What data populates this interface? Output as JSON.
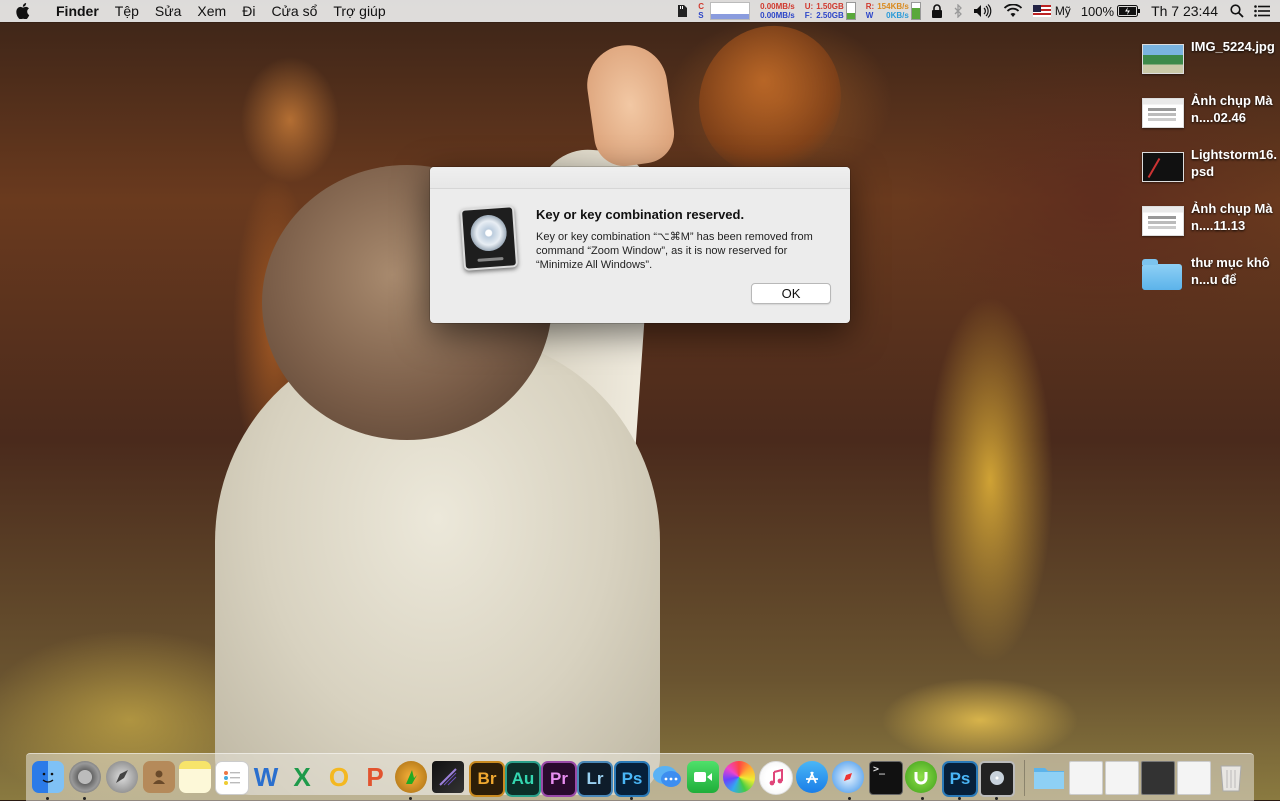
{
  "menubar": {
    "app_name": "Finder",
    "menus": [
      "Tệp",
      "Sửa",
      "Xem",
      "Đi",
      "Cửa sổ",
      "Trợ giúp"
    ],
    "status": {
      "net_up": "0.00MB/s",
      "net_down": "0.00MB/s",
      "mem_u_label": "U:",
      "mem_u": "1.50GB",
      "mem_f_label": "F:",
      "mem_f": "2.50GB",
      "disk_r_label": "R:",
      "disk_w_label": "W",
      "disk_r": "154KB/s",
      "disk_w": "0KB/s",
      "input_source": "Mỹ",
      "battery": "100%",
      "clock": "Th 7 23:44"
    }
  },
  "dialog": {
    "title": "Key or key combination reserved.",
    "message": "Key or key combination “⌥⌘M” has been removed from command “Zoom Window”, as it is now reserved for “Minimize All Windows”.",
    "ok_label": "OK"
  },
  "desktop": {
    "items": [
      {
        "label": "IMG_5224.jpg",
        "kind": "photo"
      },
      {
        "label": "Ảnh chụp Màn....02.46",
        "kind": "screenshot"
      },
      {
        "label": "Lightstorm16.psd",
        "kind": "psd"
      },
      {
        "label": "Ảnh chụp Màn....11.13",
        "kind": "screenshot"
      },
      {
        "label": "thư mục khôn...u để",
        "kind": "folder"
      }
    ]
  },
  "dock": {
    "apps": [
      {
        "name": "finder",
        "glyph": ""
      },
      {
        "name": "system-preferences",
        "glyph": ""
      },
      {
        "name": "launchpad",
        "glyph": ""
      },
      {
        "name": "contacts",
        "glyph": ""
      },
      {
        "name": "notes",
        "glyph": ""
      },
      {
        "name": "reminders",
        "glyph": ""
      },
      {
        "name": "word",
        "glyph": "W"
      },
      {
        "name": "excel",
        "glyph": "X"
      },
      {
        "name": "outlook",
        "glyph": "O"
      },
      {
        "name": "powerpoint",
        "glyph": "P"
      },
      {
        "name": "fl-studio",
        "glyph": ""
      },
      {
        "name": "final-cut",
        "glyph": ""
      },
      {
        "name": "bridge",
        "glyph": "Br"
      },
      {
        "name": "audition",
        "glyph": "Au"
      },
      {
        "name": "premiere",
        "glyph": "Pr"
      },
      {
        "name": "lightroom",
        "glyph": "Lr"
      },
      {
        "name": "photoshop",
        "glyph": "Ps"
      },
      {
        "name": "messages",
        "glyph": ""
      },
      {
        "name": "facetime",
        "glyph": ""
      },
      {
        "name": "photos",
        "glyph": ""
      },
      {
        "name": "itunes",
        "glyph": ""
      },
      {
        "name": "app-store",
        "glyph": ""
      },
      {
        "name": "safari",
        "glyph": ""
      },
      {
        "name": "terminal",
        "glyph": ""
      },
      {
        "name": "utorrent",
        "glyph": ""
      },
      {
        "name": "photoshop-2",
        "glyph": "Ps"
      },
      {
        "name": "logic-pro",
        "glyph": ""
      }
    ]
  }
}
